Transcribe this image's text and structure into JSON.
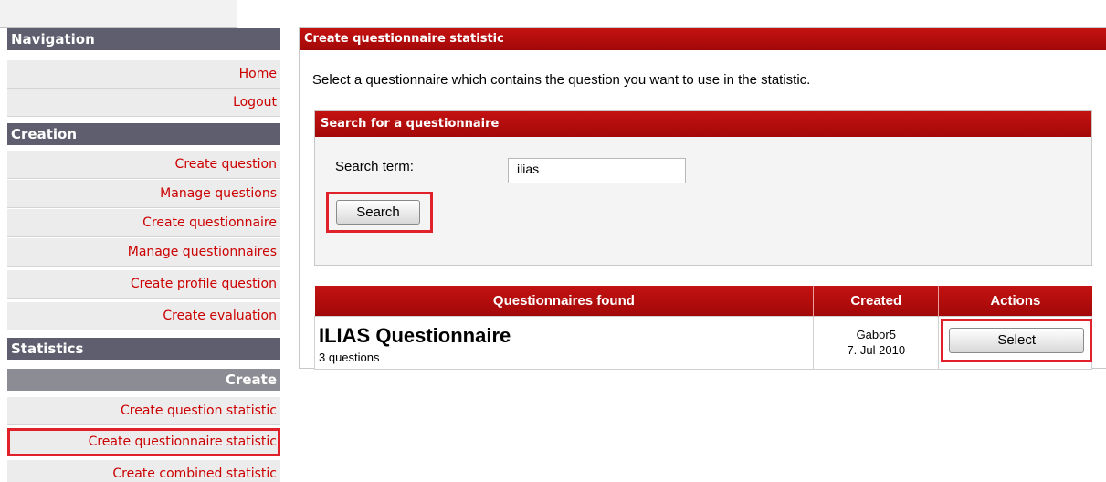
{
  "sidebar": {
    "navigation_header": "Navigation",
    "navigation_items": [
      "Home",
      "Logout"
    ],
    "creation_header": "Creation",
    "creation_items": [
      "Create question",
      "Manage questions",
      "Create questionnaire",
      "Manage questionnaires",
      "Create profile question",
      "Create evaluation"
    ],
    "statistics_header": "Statistics",
    "statistics_sub_header": "Create",
    "statistics_items": [
      "Create question statistic",
      "Create questionnaire statistic",
      "Create combined statistic"
    ]
  },
  "main": {
    "title": "Create questionnaire statistic",
    "description": "Select a questionnaire which contains the question you want to use in the statistic.",
    "search": {
      "title": "Search for a questionnaire",
      "label": "Search term:",
      "value": "ilias",
      "button_label": "Search"
    },
    "results": {
      "columns": [
        "Questionnaires found",
        "Created",
        "Actions"
      ],
      "rows": [
        {
          "name": "ILIAS Questionnaire",
          "subtitle": "3 questions",
          "author": "Gabor5",
          "date": "7. Jul 2010",
          "action_label": "Select"
        }
      ]
    }
  },
  "colors": {
    "header_red": "#b20c0c",
    "nav_header_gray": "#5e5e6e",
    "link_red": "#cc0000",
    "highlight_red": "#e0202a"
  }
}
